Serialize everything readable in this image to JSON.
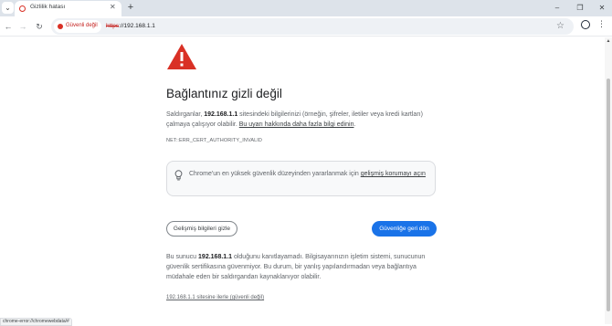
{
  "browser": {
    "tab": {
      "title": "Gizlilik hatası",
      "close": "✕"
    },
    "tab_menu": "⌄",
    "new_tab": "+",
    "window_controls": {
      "minimize": "–",
      "maximize": "❐",
      "close": "✕"
    },
    "nav": {
      "back": "←",
      "forward": "→",
      "reload": "↻"
    },
    "security_chip": {
      "label": "Güvenli değil",
      "color": "#d93025"
    },
    "url": {
      "scheme": "https",
      "rest": "://192.168.1.1"
    },
    "bookmark": "☆",
    "menu": "⋮"
  },
  "page": {
    "title": "Bağlantınız gizli değil",
    "intro": {
      "part1": "Saldırganlar, ",
      "host": "192.168.1.1",
      "part2": " sitesindeki bilgilerinizi (örneğin, şifreler, iletiler veya kredi kartları) çalmaya çalışıyor olabilir. ",
      "link": "Bu uyarı hakkında daha fazla bilgi edinin",
      "part3": "."
    },
    "error_code": "NET::ERR_CERT_AUTHORITY_INVALID",
    "enhanced": {
      "text": "Chrome'un en yüksek güvenlik düzeyinden yararlanmak için ",
      "link": "gelişmiş korumayı açın"
    },
    "buttons": {
      "details": "Gelişmiş bilgileri gizle",
      "back": "Güvenliğe geri dön"
    },
    "details": {
      "part1": "Bu sunucu ",
      "host": "192.168.1.1",
      "part2": " olduğunu kanıtlayamadı. Bilgisayarınızın işletim sistemi, sunucunun güvenlik sertifikasına güvenmiyor. Bu durum, bir yanlış yapılandırmadan veya bağlantıya müdahale eden bir saldırgandan kaynaklanıyor olabilir."
    },
    "proceed_link": "192.168.1.1 sitesine ilerle (güvenli değil)"
  },
  "status_bar": "chrome-error://chromewebdata/#",
  "colors": {
    "accent": "#1a73e8",
    "warning": "#d93025"
  }
}
